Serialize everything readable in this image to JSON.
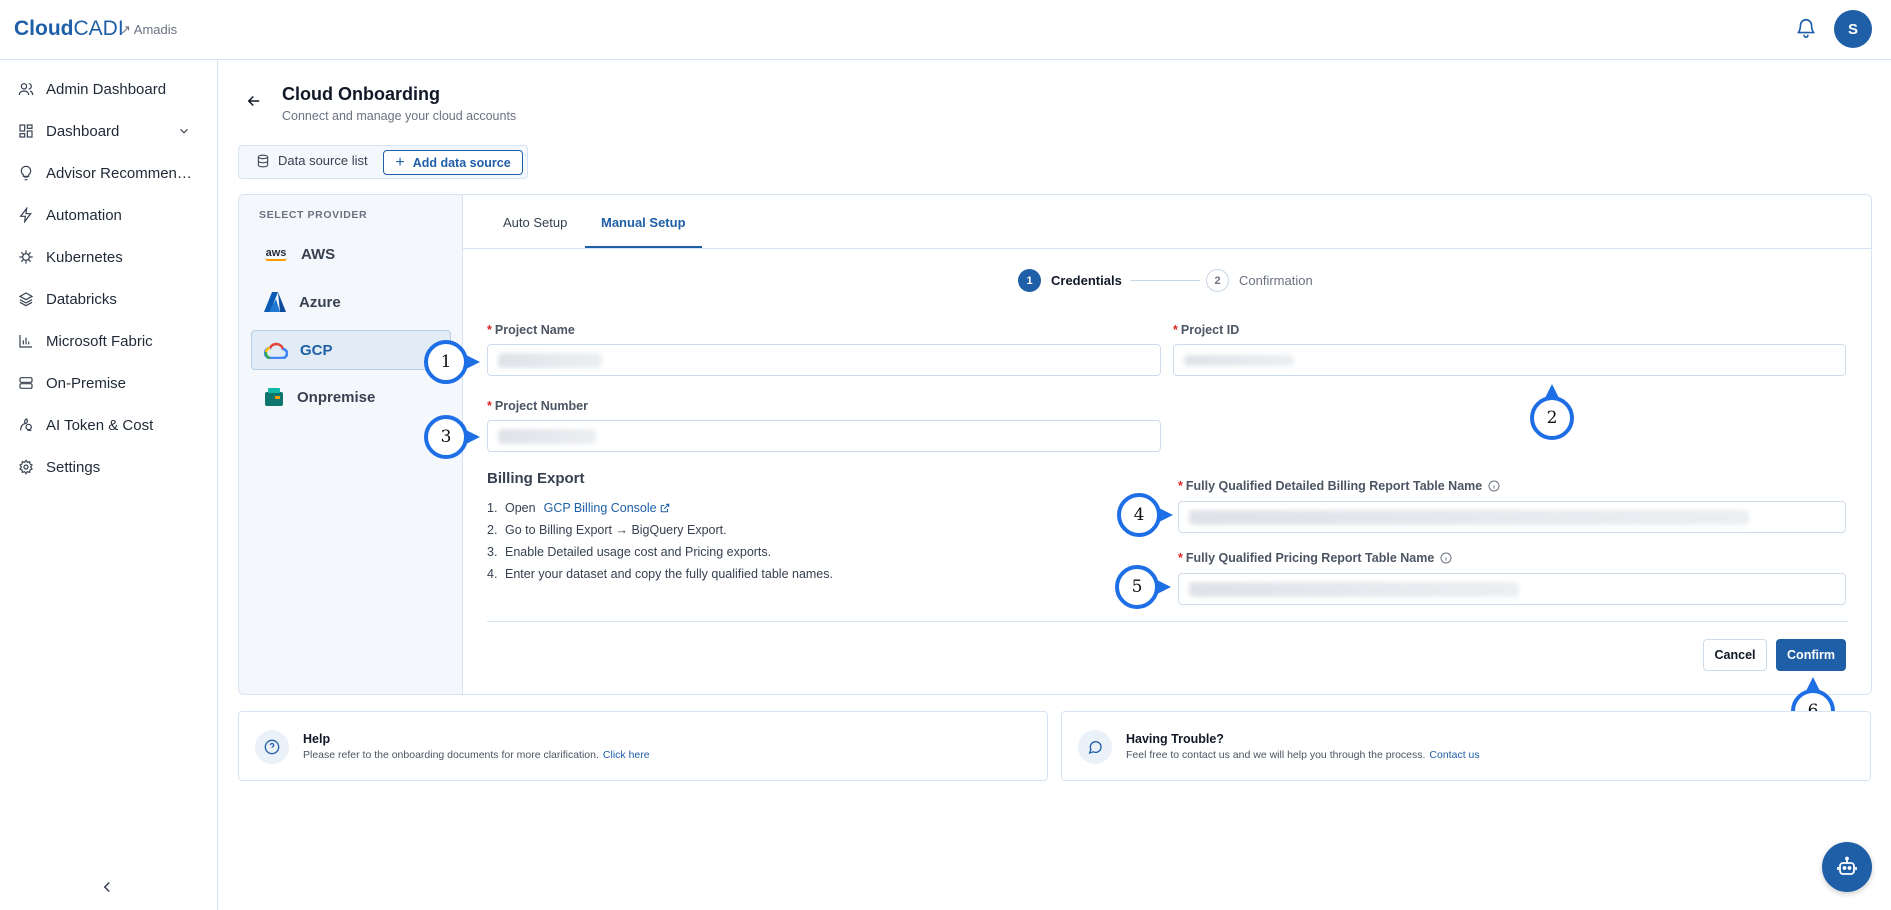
{
  "header": {
    "logo_bold": "Cloud",
    "logo_thin": "CADI",
    "org_name": "↗ Amadis",
    "avatar_initial": "S",
    "bell_icon": "bell-icon"
  },
  "sidebar": {
    "items": [
      {
        "label": "Admin Dashboard",
        "icon": "users-icon"
      },
      {
        "label": "Dashboard",
        "icon": "grid-icon",
        "expandable": true
      },
      {
        "label": "Advisor Recommend...",
        "icon": "lightbulb-icon"
      },
      {
        "label": "Automation",
        "icon": "bolt-icon"
      },
      {
        "label": "Kubernetes",
        "icon": "helm-icon"
      },
      {
        "label": "Databricks",
        "icon": "layers-icon"
      },
      {
        "label": "Microsoft Fabric",
        "icon": "bar-chart-icon"
      },
      {
        "label": "On-Premise",
        "icon": "server-icon"
      },
      {
        "label": "AI Token & Cost",
        "icon": "ai-icon"
      },
      {
        "label": "Settings",
        "icon": "gear-icon"
      }
    ]
  },
  "page": {
    "title": "Cloud Onboarding",
    "subtitle": "Connect and manage your cloud accounts",
    "data_source_list": "Data source list",
    "add_data_source": "Add data source"
  },
  "providers": {
    "heading": "SELECT PROVIDER",
    "items": [
      {
        "name": "AWS",
        "active": false
      },
      {
        "name": "Azure",
        "active": false
      },
      {
        "name": "GCP",
        "active": true
      },
      {
        "name": "Onpremise",
        "active": false
      }
    ]
  },
  "tabs": {
    "auto": "Auto Setup",
    "manual": "Manual Setup",
    "active": "Manual Setup"
  },
  "steps": [
    {
      "num": "1",
      "label": "Credentials",
      "active": true
    },
    {
      "num": "2",
      "label": "Confirmation",
      "active": false
    }
  ],
  "form": {
    "required_mark": "*",
    "project_name_label": "Project Name",
    "project_id_label": "Project ID",
    "project_number_label": "Project Number",
    "detailed_billing_label": "Fully Qualified Detailed Billing Report Table Name",
    "pricing_label": "Fully Qualified Pricing Report Table Name"
  },
  "billing": {
    "title": "Billing Export",
    "steps": [
      {
        "n": "1.",
        "text": "Open",
        "link": "GCP Billing Console"
      },
      {
        "n": "2.",
        "text": "Go to Billing Export → BigQuery Export."
      },
      {
        "n": "3.",
        "text": "Enable Detailed usage cost and Pricing exports."
      },
      {
        "n": "4.",
        "text": "Enter your dataset and copy the fully qualified table names."
      }
    ]
  },
  "buttons": {
    "cancel": "Cancel",
    "confirm": "Confirm"
  },
  "annotations": [
    "1",
    "2",
    "3",
    "4",
    "5",
    "6"
  ],
  "help": {
    "title": "Help",
    "text": "Please refer to the onboarding documents for more clarification.",
    "link": "Click here"
  },
  "trouble": {
    "title": "Having Trouble?",
    "text": "Feel free to contact us and we will help you through the process.",
    "link": "Contact us"
  },
  "colors": {
    "brand": "#1f5fa8",
    "annotation": "#1e6fe6",
    "required": "#dc2626"
  }
}
